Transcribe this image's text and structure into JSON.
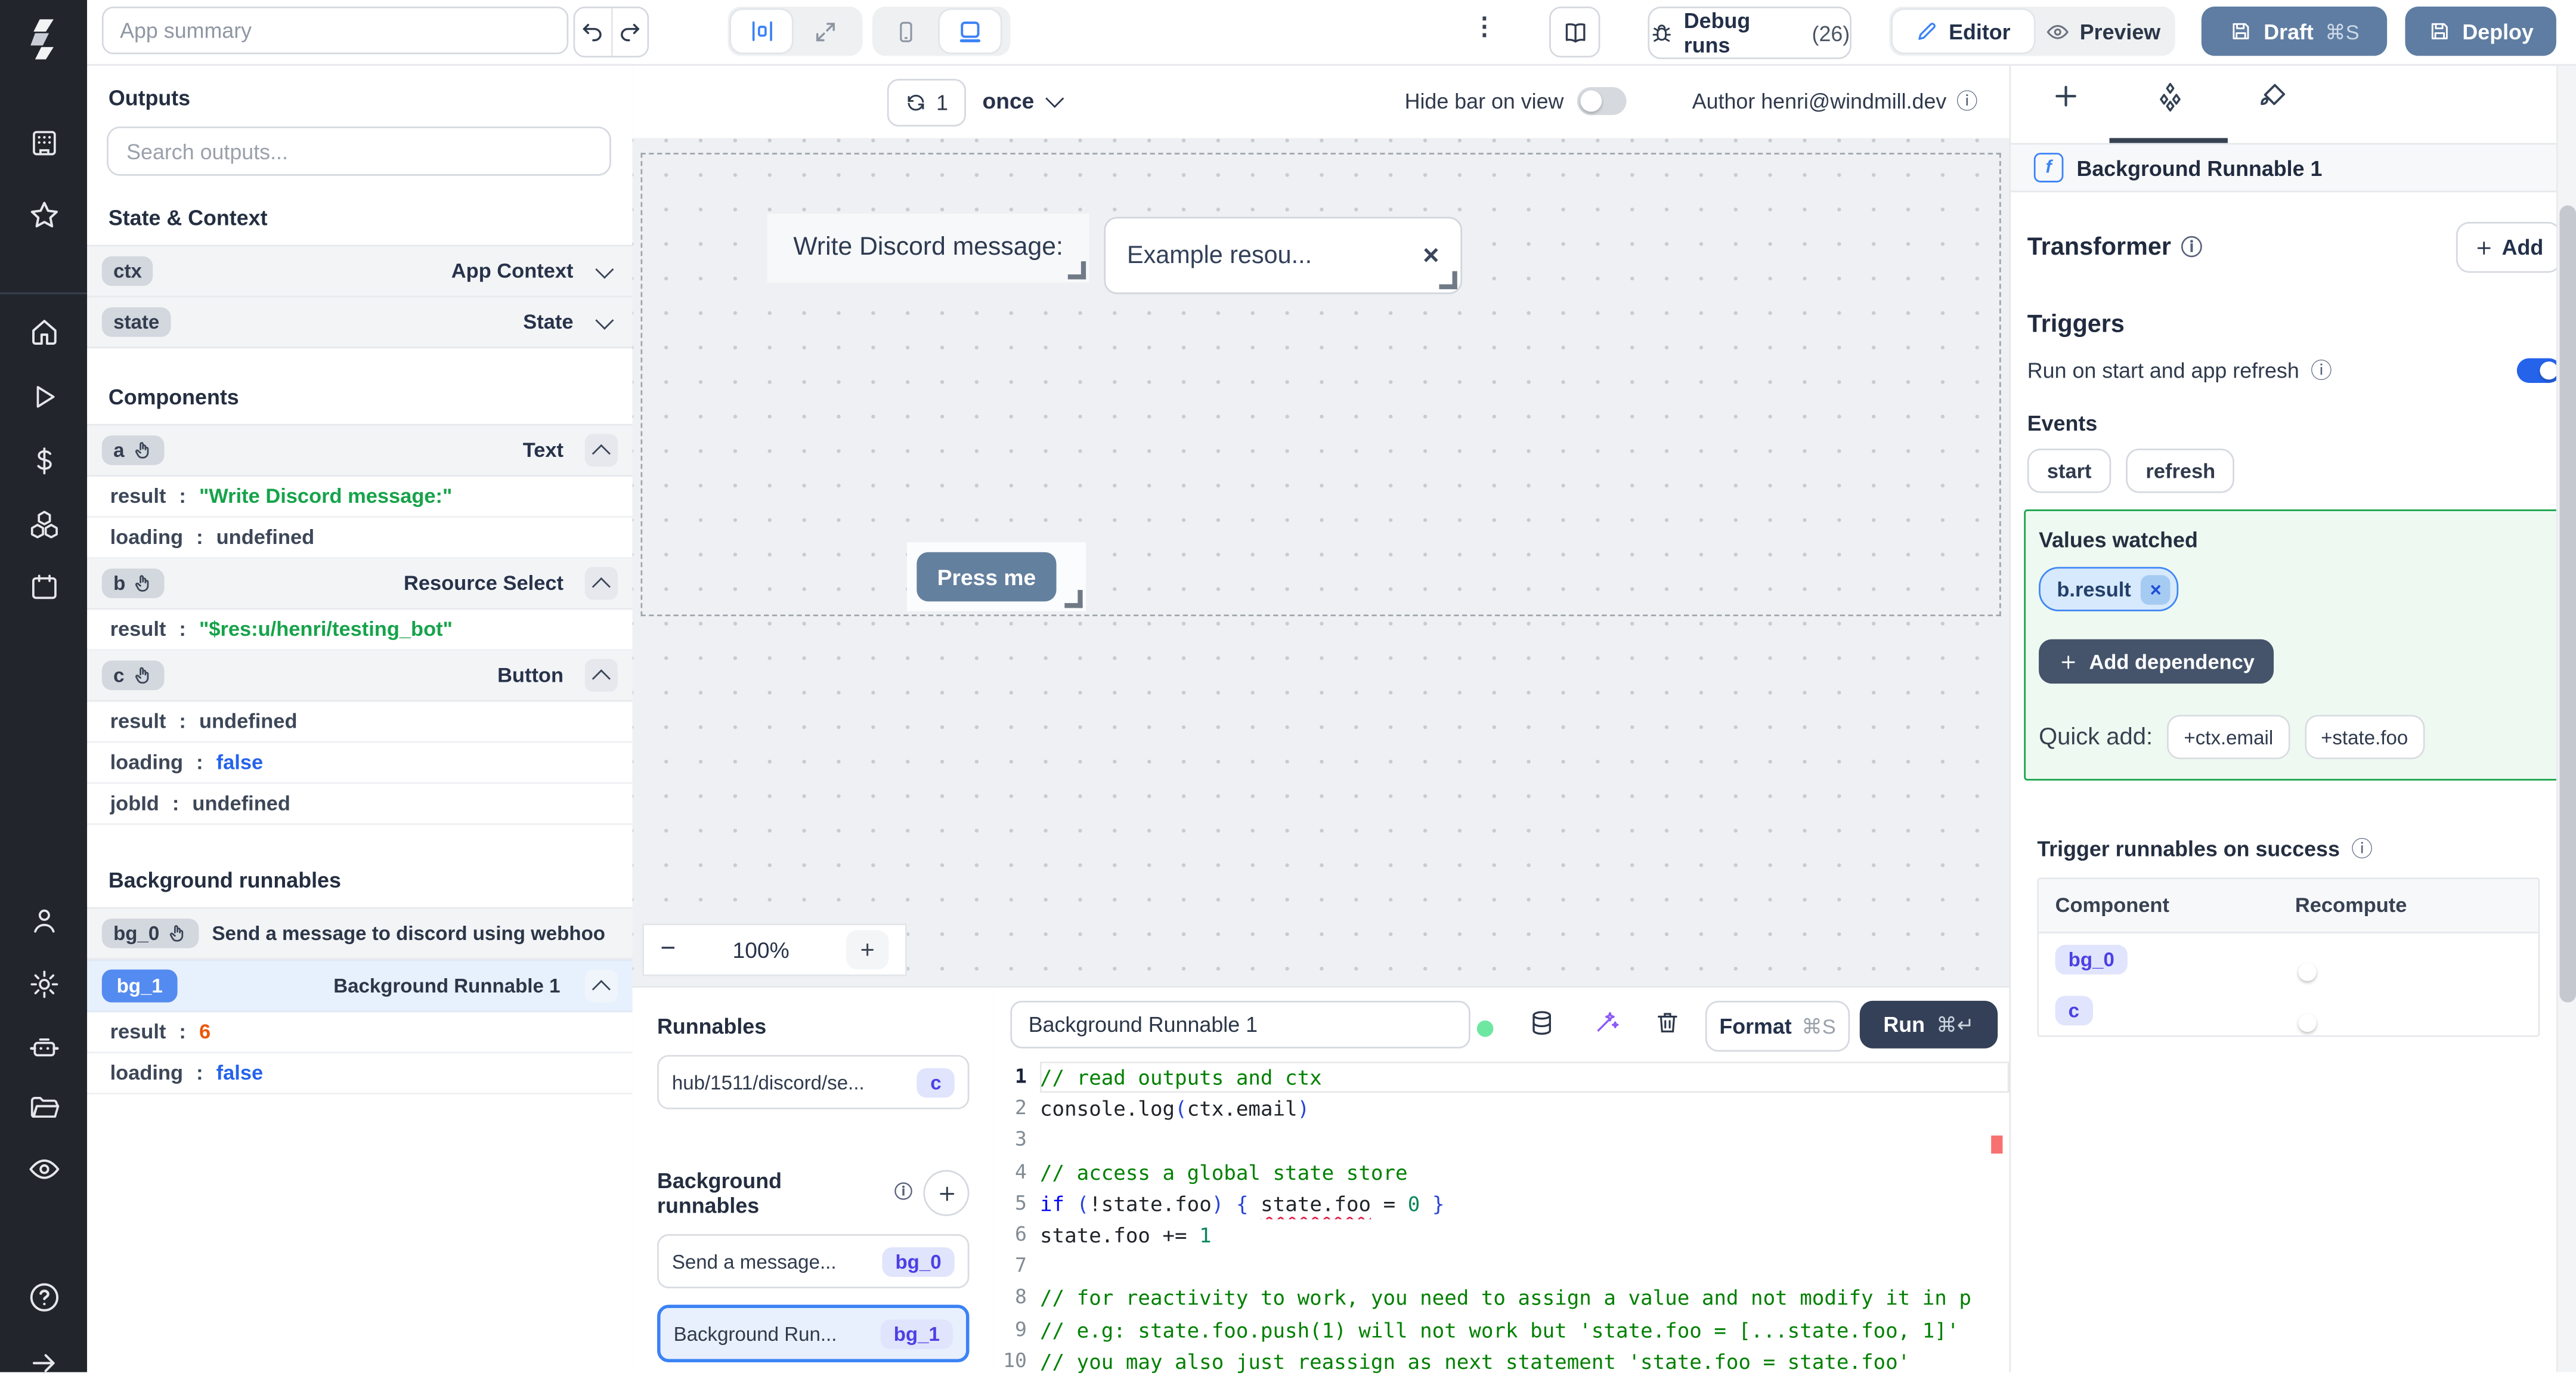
{
  "palette": {
    "accent_blue": "#3b82f6",
    "slate_button": "#5f7da2",
    "run_button": "#344057",
    "green_border": "#16a34a",
    "string_green": "#16a34a",
    "bool_blue": "#2563eb",
    "num_orange": "#ea580c",
    "rail_bg": "#22262c"
  },
  "misc": {
    "sep": ":",
    "close": "×",
    "kebab": "⋮",
    "info": "ⓘ",
    "minus": "−",
    "plus": "+"
  },
  "topbar": {
    "app_summary_placeholder": "App summary",
    "debug_runs_label": "Debug runs",
    "debug_runs_count": "(26)",
    "editor_label": "Editor",
    "preview_label": "Preview",
    "draft_label": "Draft",
    "draft_shortcut": "⌘S",
    "deploy_label": "Deploy"
  },
  "outputs_panel": {
    "title": "Outputs",
    "search_placeholder": "Search outputs...",
    "state_context_title": "State & Context",
    "ctx": {
      "id": "ctx",
      "type": "App Context"
    },
    "state": {
      "id": "state",
      "type": "State"
    },
    "components_title": "Components",
    "components": [
      {
        "id": "a",
        "type": "Text",
        "props": [
          {
            "k": "result",
            "v": "\"Write Discord message:\""
          },
          {
            "k": "loading",
            "v": "undefined"
          }
        ]
      },
      {
        "id": "b",
        "type": "Resource Select",
        "props": [
          {
            "k": "result",
            "v": "\"$res:u/henri/testing_bot\""
          }
        ]
      },
      {
        "id": "c",
        "type": "Button",
        "props": [
          {
            "k": "result",
            "v": "undefined"
          },
          {
            "k": "loading",
            "v": "false"
          },
          {
            "k": "jobId",
            "v": "undefined"
          }
        ]
      }
    ],
    "background_title": "Background runnables",
    "bg0": {
      "id": "bg_0",
      "label": "Send a message to discord using webhoo"
    },
    "bg1": {
      "id": "bg_1",
      "label": "Background Runnable 1",
      "props": [
        {
          "k": "result",
          "v": "6"
        },
        {
          "k": "loading",
          "v": "false"
        }
      ]
    }
  },
  "canvas": {
    "refresh_count": "1",
    "interval_label": "once",
    "hide_bar_label": "Hide bar on view",
    "author_label": "Author henri@windmill.dev",
    "zoom_out": "−",
    "zoom_level": "100%",
    "zoom_in": "+",
    "text_component": "Write Discord message:",
    "resource_select_value": "Example resou...",
    "button_label": "Press me"
  },
  "runnables_panel": {
    "title": "Runnables",
    "hub_item": {
      "label": "hub/1511/discord/se...",
      "badge": "c"
    },
    "background_title": "Background runnables",
    "items": [
      {
        "label": "Send a message...",
        "badge": "bg_0"
      },
      {
        "label": "Background Run...",
        "badge": "bg_1"
      }
    ]
  },
  "editor": {
    "name_value": "Background Runnable 1",
    "format_label": "Format",
    "format_shortcut": "⌘S",
    "run_label": "Run",
    "run_shortcut": "⌘↵",
    "lines": [
      {
        "n": "1",
        "segments": [
          {
            "t": "// read outputs and ctx",
            "c": "cm"
          }
        ]
      },
      {
        "n": "2",
        "segments": [
          {
            "t": "console.log",
            "c": "d"
          },
          {
            "t": "(",
            "c": "br"
          },
          {
            "t": "ctx.email",
            "c": "d"
          },
          {
            "t": ")",
            "c": "br"
          }
        ]
      },
      {
        "n": "3",
        "segments": []
      },
      {
        "n": "4",
        "segments": [
          {
            "t": "// access a global state store",
            "c": "cm"
          }
        ]
      },
      {
        "n": "5",
        "segments": [
          {
            "t": "if",
            "c": "kw"
          },
          {
            "t": " ",
            "c": "d"
          },
          {
            "t": "(",
            "c": "br"
          },
          {
            "t": "!state.foo",
            "c": "d"
          },
          {
            "t": ")",
            "c": "br"
          },
          {
            "t": " ",
            "c": "d"
          },
          {
            "t": "{",
            "c": "br"
          },
          {
            "t": " ",
            "c": "d"
          },
          {
            "t": "state.foo",
            "c": "d sq"
          },
          {
            "t": " = ",
            "c": "d"
          },
          {
            "t": "0",
            "c": "num"
          },
          {
            "t": " ",
            "c": "d"
          },
          {
            "t": "}",
            "c": "br"
          }
        ]
      },
      {
        "n": "6",
        "segments": [
          {
            "t": "state.foo += ",
            "c": "d"
          },
          {
            "t": "1",
            "c": "num"
          }
        ]
      },
      {
        "n": "7",
        "segments": []
      },
      {
        "n": "8",
        "segments": [
          {
            "t": "// for reactivity to work, you need to assign a value and not modify it in p",
            "c": "cm"
          }
        ]
      },
      {
        "n": "9",
        "segments": [
          {
            "t": "// e.g: state.foo.push(1) will not work but 'state.foo = [...state.foo, 1]'",
            "c": "cm"
          }
        ]
      },
      {
        "n": "10",
        "segments": [
          {
            "t": "// you may also just reassign as next statement 'state.foo = state.foo'",
            "c": "cm"
          }
        ]
      }
    ]
  },
  "right_panel": {
    "selected_component": "Background Runnable 1",
    "transformer_title": "Transformer",
    "add_label": "Add",
    "triggers_title": "Triggers",
    "run_on_start_label": "Run on start and app refresh",
    "events_title": "Events",
    "event_chips": [
      "start",
      "refresh"
    ],
    "values_watched_title": "Values watched",
    "watched_chip": "b.result",
    "add_dependency_label": "Add dependency",
    "quick_add_label": "Quick add:",
    "quick_add_chips": [
      "+ctx.email",
      "+state.foo"
    ],
    "trigger_on_success_title": "Trigger runnables on success",
    "table": {
      "headers": [
        "Component",
        "Recompute"
      ],
      "rows": [
        {
          "component": "bg_0"
        },
        {
          "component": "c"
        }
      ]
    }
  }
}
